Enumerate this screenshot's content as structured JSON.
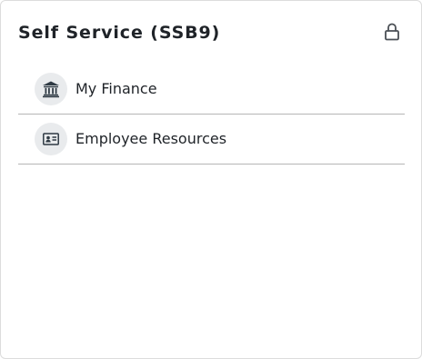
{
  "card": {
    "title": "Self Service (SSB9)",
    "lock_icon": "lock-icon"
  },
  "items": [
    {
      "label": "My Finance",
      "icon": "bank-icon"
    },
    {
      "label": "Employee Resources",
      "icon": "id-card-icon"
    }
  ],
  "colors": {
    "text": "#1f2328",
    "icon_bg": "#e9ebed",
    "icon": "#2f3a44",
    "divider": "#b5b5b5"
  }
}
